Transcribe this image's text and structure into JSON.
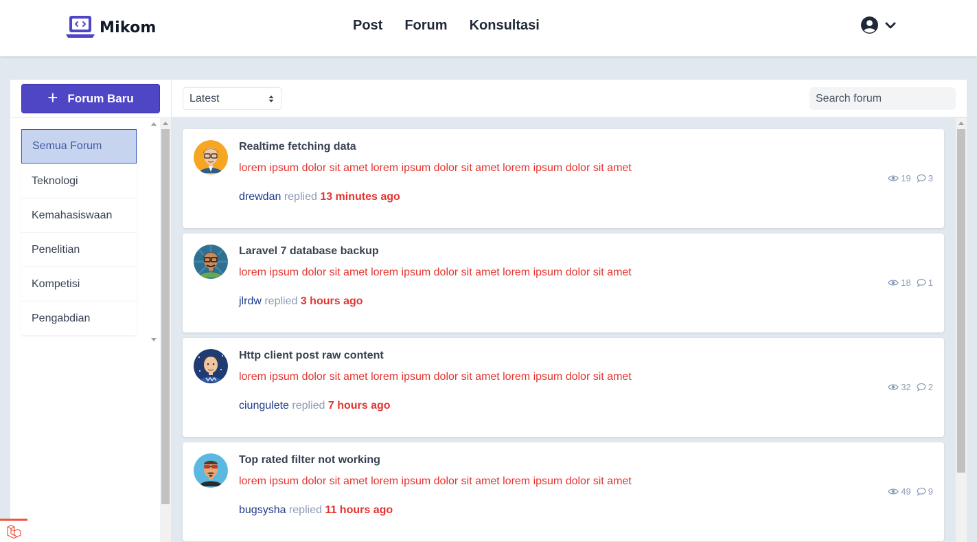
{
  "header": {
    "brand": "Mikom",
    "nav": [
      "Post",
      "Forum",
      "Konsultasi"
    ]
  },
  "sidebar": {
    "new_forum_label": "Forum Baru",
    "categories": [
      "Semua Forum",
      "Teknologi",
      "Kemahasiswaan",
      "Penelitian",
      "Kompetisi",
      "Pengabdian"
    ],
    "active_category": "Semua Forum"
  },
  "toolbar": {
    "sort_selected": "Latest",
    "search_placeholder": "Search forum"
  },
  "threads": [
    {
      "title": "Realtime fetching data",
      "excerpt": "lorem ipsum dolor sit amet lorem ipsum dolor sit amet lorem ipsum dolor sit amet",
      "user": "drewdan",
      "verb": "replied",
      "time": "13 minutes ago",
      "views": "19",
      "comments": "3"
    },
    {
      "title": "Laravel 7 database backup",
      "excerpt": "lorem ipsum dolor sit amet lorem ipsum dolor sit amet lorem ipsum dolor sit amet",
      "user": "jlrdw",
      "verb": "replied",
      "time": "3 hours ago",
      "views": "18",
      "comments": "1"
    },
    {
      "title": "Http client post raw content",
      "excerpt": "lorem ipsum dolor sit amet lorem ipsum dolor sit amet lorem ipsum dolor sit amet",
      "user": "ciungulete",
      "verb": "replied",
      "time": "7 hours ago",
      "views": "32",
      "comments": "2"
    },
    {
      "title": "Top rated filter not working",
      "excerpt": "lorem ipsum dolor sit amet lorem ipsum dolor sit amet lorem ipsum dolor sit amet",
      "user": "bugsysha",
      "verb": "replied",
      "time": "11 hours ago",
      "views": "49",
      "comments": "9"
    }
  ],
  "colors": {
    "brand_primary": "#4f46c6",
    "excerpt_red": "#e3342f",
    "username_blue": "#1e3a8a",
    "page_background": "#e2e8f0"
  },
  "icons": [
    "laptop-code-logo-icon",
    "user-circle-icon",
    "chevron-down-icon",
    "plus-icon",
    "select-caret-icon",
    "eye-icon",
    "comment-icon",
    "laravel-icon"
  ]
}
